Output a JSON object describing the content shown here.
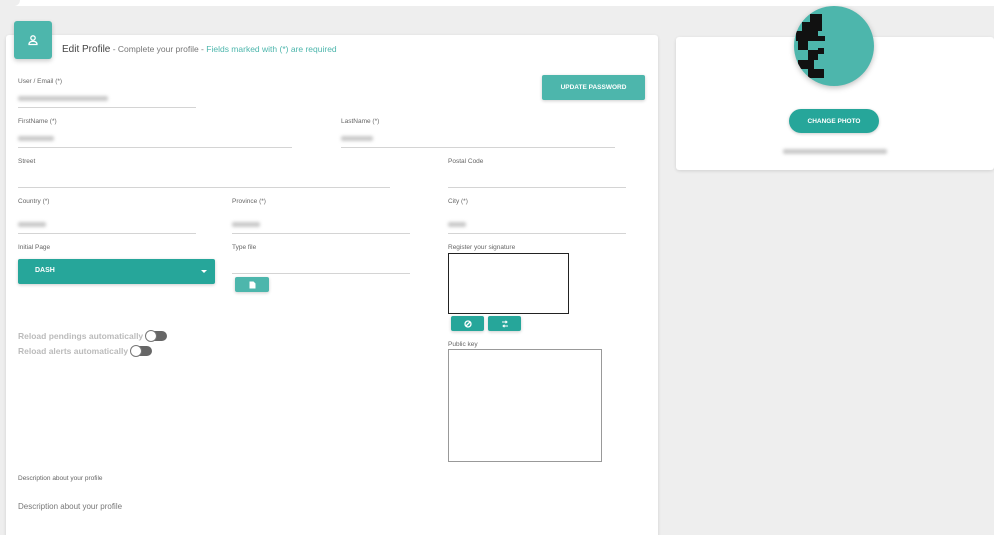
{
  "header": {
    "title": "Edit Profile",
    "subtitle": " - Complete your profile - ",
    "required_note": "Fields marked with (*) are required",
    "icon": "user-icon"
  },
  "fields": {
    "user_email_label": "User / Email (*)",
    "firstname_label": "FirstName (*)",
    "lastname_label": "LastName (*)",
    "street_label": "Street",
    "postal_label": "Postal Code",
    "country_label": "Country (*)",
    "province_label": "Province (*)",
    "city_label": "City (*)",
    "initial_page_label": "Initial Page",
    "initial_page_value": "DASH",
    "type_file_label": "Type file",
    "signature_label": "Register your signature",
    "public_key_label": "Public key",
    "description_label": "Description about your profile",
    "description_placeholder": "Description about your profile"
  },
  "buttons": {
    "update_password": "UPDATE PASSWORD",
    "change_photo": "CHANGE PHOTO"
  },
  "toggles": {
    "reload_pendings": "Reload pendings automatically",
    "reload_alerts": "Reload alerts automatically"
  },
  "colors": {
    "accent": "#4db6ac",
    "accent_dark": "#26a69a",
    "required_text": "#4db6ac"
  }
}
